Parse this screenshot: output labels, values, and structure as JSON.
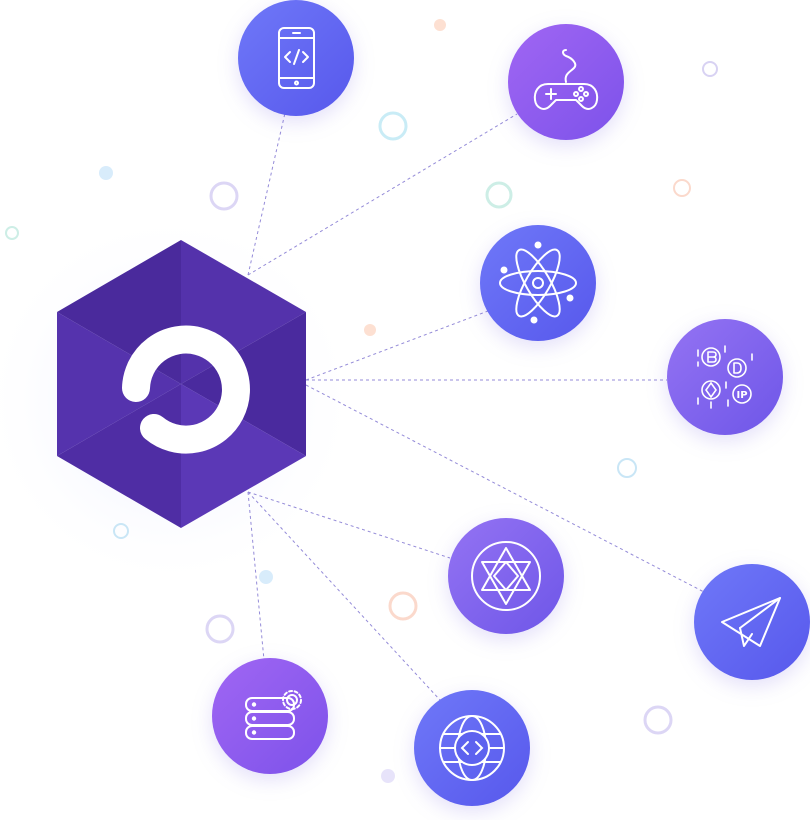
{
  "colors": {
    "hex_top": "#4d2ba0",
    "hex_left": "#4a279e",
    "hex_right": "#5b36b8",
    "hex_logo": "#ffffff",
    "line": "#8f86d6",
    "icon_stroke": "#ffffff",
    "grad_blue_start": "#6a72f7",
    "grad_blue_end": "#5a5cef",
    "grad_purple_start": "#9a62f2",
    "grad_purple_end": "#7c52ea",
    "grad_violet_start": "#8b6cf2",
    "grad_violet_end": "#6f55e8"
  },
  "hub": {
    "icon": "loop-logo-icon"
  },
  "nodes": [
    {
      "id": "mobile-dev",
      "icon": "smartphone-code-icon"
    },
    {
      "id": "gaming",
      "icon": "gamepad-icon"
    },
    {
      "id": "science",
      "icon": "atom-icon"
    },
    {
      "id": "crypto",
      "icon": "crypto-coins-icon"
    },
    {
      "id": "network",
      "icon": "star-network-icon"
    },
    {
      "id": "messaging",
      "icon": "paper-plane-icon"
    },
    {
      "id": "database",
      "icon": "database-gear-icon"
    },
    {
      "id": "global",
      "icon": "globe-code-icon"
    }
  ]
}
